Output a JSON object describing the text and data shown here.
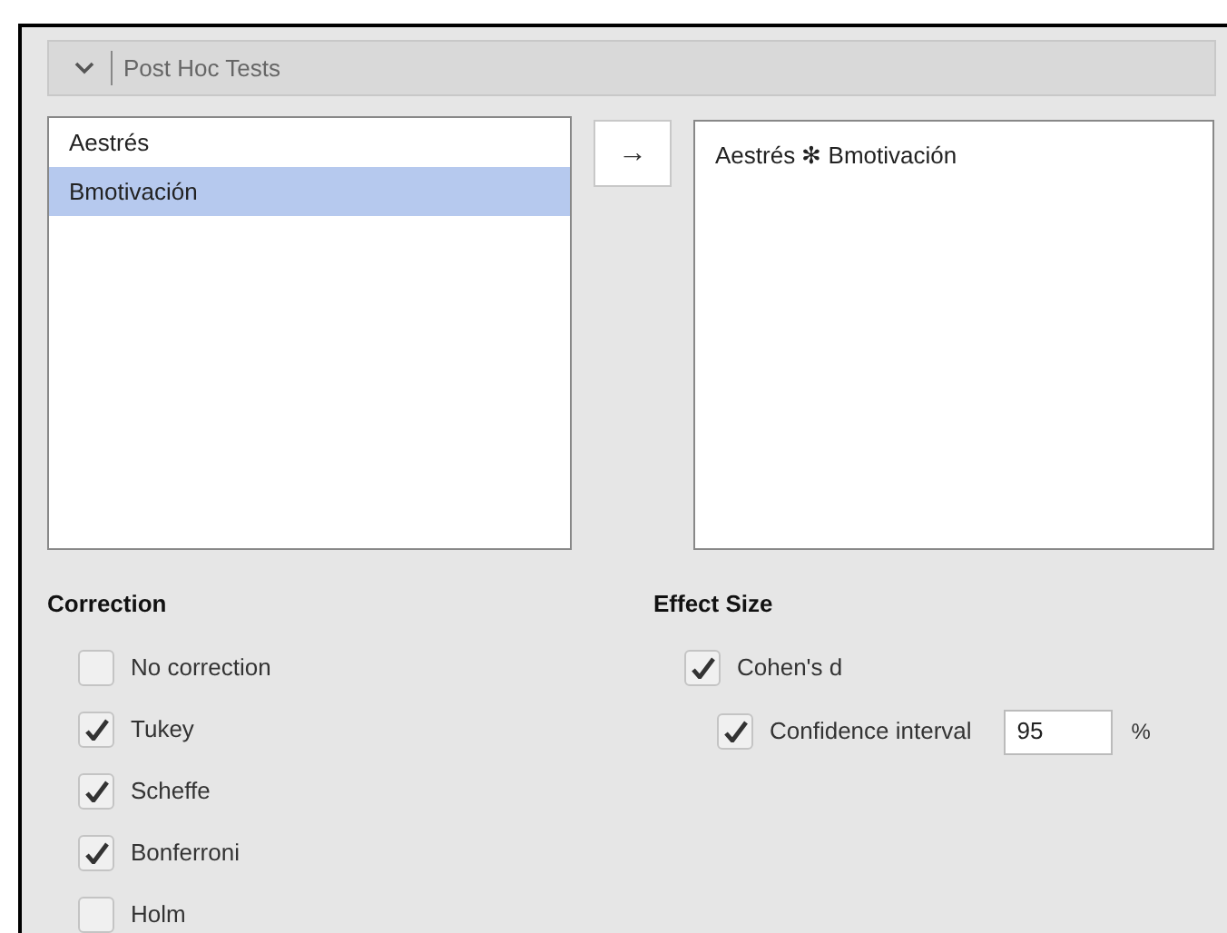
{
  "section": {
    "title": "Post Hoc Tests",
    "expanded": true
  },
  "available": [
    {
      "label": "Aestrés",
      "selected": false
    },
    {
      "label": "Bmotivación",
      "selected": true
    }
  ],
  "move_button": {
    "label": "→"
  },
  "chosen": [
    {
      "label": "Aestrés ✻ Bmotivación",
      "selected": false
    }
  ],
  "correction": {
    "heading": "Correction",
    "options": [
      {
        "label": "No correction",
        "checked": false
      },
      {
        "label": "Tukey",
        "checked": true
      },
      {
        "label": "Scheffe",
        "checked": true
      },
      {
        "label": "Bonferroni",
        "checked": true
      },
      {
        "label": "Holm",
        "checked": false
      }
    ]
  },
  "effect_size": {
    "heading": "Effect Size",
    "cohens_d": {
      "label": "Cohen's d",
      "checked": true
    },
    "confidence_interval": {
      "label": "Confidence interval",
      "checked": true,
      "value": "95",
      "unit": "%"
    }
  }
}
